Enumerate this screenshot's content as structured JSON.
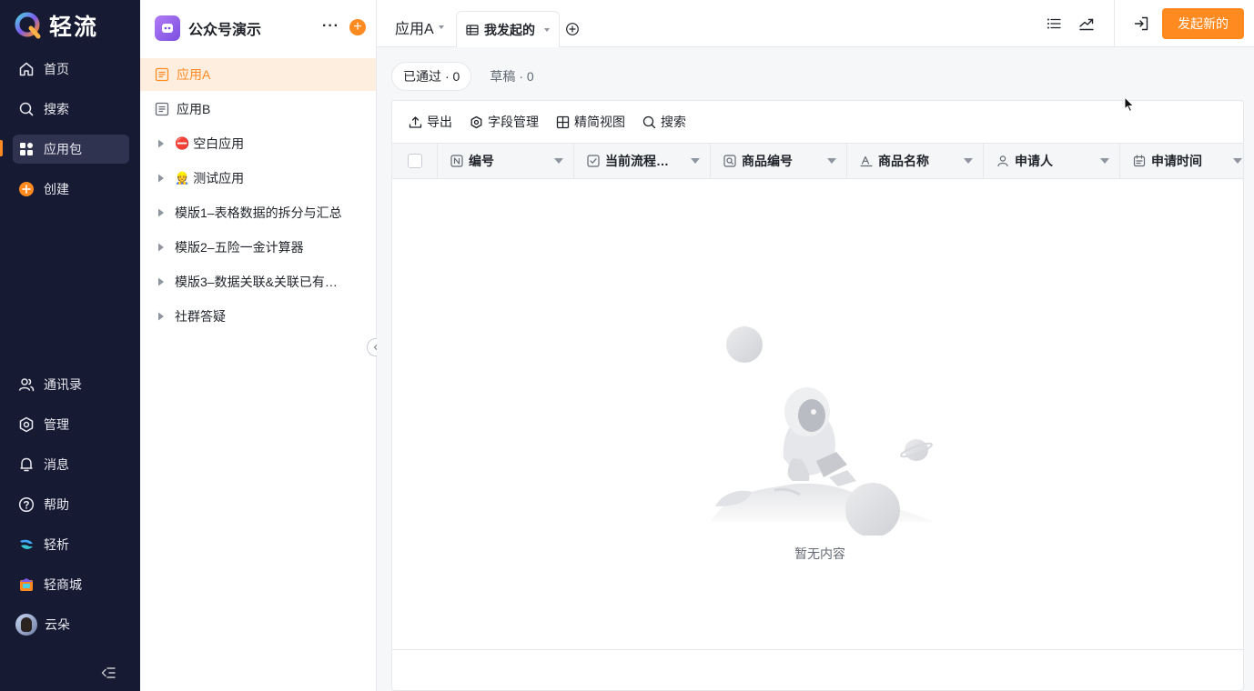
{
  "brand": {
    "name": "轻流"
  },
  "sidebar": {
    "nav": [
      {
        "label": "首页",
        "icon": "home-icon"
      },
      {
        "label": "搜索",
        "icon": "search-icon"
      },
      {
        "label": "应用包",
        "icon": "apps-grid-icon",
        "active": true
      },
      {
        "label": "创建",
        "icon": "plus-circle-icon"
      }
    ],
    "bottom": [
      {
        "label": "通讯录",
        "icon": "contacts-icon"
      },
      {
        "label": "管理",
        "icon": "settings-icon"
      },
      {
        "label": "消息",
        "icon": "bell-icon"
      },
      {
        "label": "帮助",
        "icon": "help-icon"
      },
      {
        "label": "轻析",
        "icon": "analytics-logo-icon"
      },
      {
        "label": "轻商城",
        "icon": "store-logo-icon"
      }
    ],
    "user": {
      "name": "云朵"
    },
    "accent": "#ff8a1f",
    "background": "#171a33"
  },
  "panel": {
    "package_name": "公众号演示",
    "items": [
      {
        "label": "应用A",
        "type": "app",
        "selected": true
      },
      {
        "label": "应用B",
        "type": "app"
      },
      {
        "label": "空白应用",
        "type": "group",
        "emoji": "⛔"
      },
      {
        "label": "测试应用",
        "type": "group",
        "emoji": "👷"
      },
      {
        "label": "模版1–表格数据的拆分与汇总",
        "type": "group"
      },
      {
        "label": "模版2–五险一金计算器",
        "type": "group"
      },
      {
        "label": "模版3–数据关联&关联已有…",
        "type": "group"
      },
      {
        "label": "社群答疑",
        "type": "group"
      }
    ]
  },
  "topbar": {
    "app_title": "应用A",
    "view_tab": "我发起的",
    "new_button": "发起新的"
  },
  "status_filters": [
    {
      "label": "已通过",
      "count": "· 0",
      "active": true
    },
    {
      "label": "草稿",
      "count": "· 0",
      "active": false
    }
  ],
  "toolbar": {
    "export": "导出",
    "fields": "字段管理",
    "simple_view": "精简视图",
    "search": "搜索"
  },
  "table": {
    "columns": [
      {
        "label": "编号",
        "icon": "number-field-icon"
      },
      {
        "label": "当前流程…",
        "icon": "checkbox-field-icon"
      },
      {
        "label": "商品编号",
        "icon": "search-field-icon"
      },
      {
        "label": "商品名称",
        "icon": "text-field-icon"
      },
      {
        "label": "申请人",
        "icon": "user-field-icon"
      },
      {
        "label": "申请时间",
        "icon": "date-field-icon"
      }
    ],
    "empty_text": "暂无内容"
  }
}
